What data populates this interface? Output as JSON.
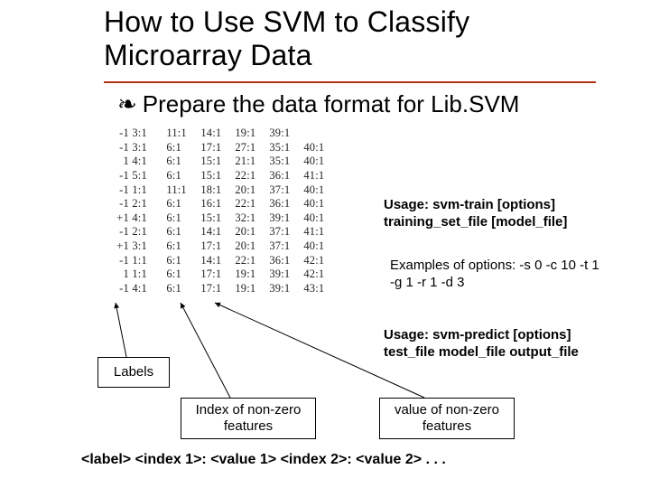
{
  "title": "How to Use SVM to Classify Microarray Data",
  "bullet": "Prepare the data format for Lib.SVM",
  "data_rows": [
    {
      "label": "-1",
      "cells": [
        "3:1",
        "11:1",
        "14:1",
        "19:1",
        "39:1"
      ]
    },
    {
      "label": "-1",
      "cells": [
        "3:1",
        "6:1",
        "17:1",
        "27:1",
        "35:1",
        "40:1"
      ]
    },
    {
      "label": "1",
      "cells": [
        "4:1",
        "6:1",
        "15:1",
        "21:1",
        "35:1",
        "40:1"
      ]
    },
    {
      "label": "-1",
      "cells": [
        "5:1",
        "6:1",
        "15:1",
        "22:1",
        "36:1",
        "41:1"
      ]
    },
    {
      "label": "-1",
      "cells": [
        "1:1",
        "11:1",
        "18:1",
        "20:1",
        "37:1",
        "40:1"
      ]
    },
    {
      "label": "-1",
      "cells": [
        "2:1",
        "6:1",
        "16:1",
        "22:1",
        "36:1",
        "40:1"
      ]
    },
    {
      "label": "+1",
      "cells": [
        "4:1",
        "6:1",
        "15:1",
        "32:1",
        "39:1",
        "40:1"
      ]
    },
    {
      "label": "-1",
      "cells": [
        "2:1",
        "6:1",
        "14:1",
        "20:1",
        "37:1",
        "41:1"
      ]
    },
    {
      "label": "+1",
      "cells": [
        "3:1",
        "6:1",
        "17:1",
        "20:1",
        "37:1",
        "40:1"
      ]
    },
    {
      "label": "-1",
      "cells": [
        "1:1",
        "6:1",
        "14:1",
        "22:1",
        "36:1",
        "42:1"
      ]
    },
    {
      "label": "1",
      "cells": [
        "1:1",
        "6:1",
        "17:1",
        "19:1",
        "39:1",
        "42:1"
      ]
    },
    {
      "label": "-1",
      "cells": [
        "4:1",
        "6:1",
        "17:1",
        "19:1",
        "39:1",
        "43:1"
      ]
    }
  ],
  "usage_train": "Usage: svm-train [options] training_set_file [model_file]",
  "examples": "Examples of options: -s 0 -c 10 -t 1 -g 1 -r 1 -d 3",
  "usage_predict": "Usage: svm-predict [options] test_file model_file output_file",
  "box_labels": "Labels",
  "box_index": "Index of non-zero features",
  "box_value": "value of non-zero features",
  "format_line": "<label> <index 1>: <value 1> <index 2>: <value 2> . . ."
}
